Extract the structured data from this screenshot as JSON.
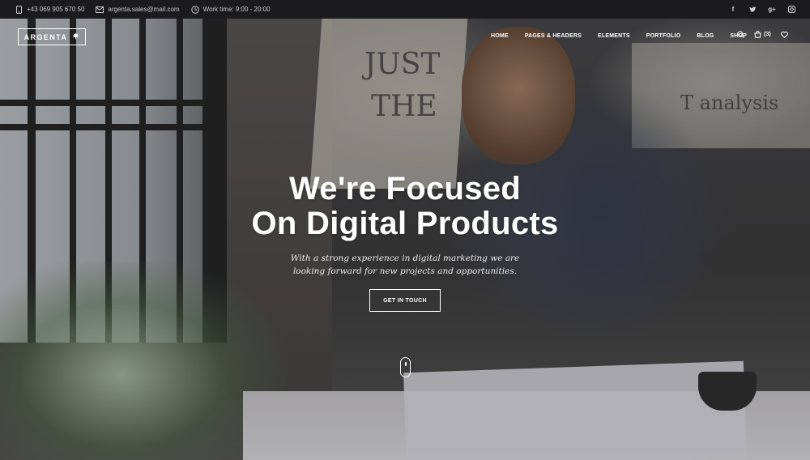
{
  "topbar": {
    "phone": "+43 069 905 670 50",
    "email": "argenta.sales@mail.com",
    "work_time": "Work time: 9:00 - 20:00",
    "social": [
      {
        "icon": "facebook-icon",
        "glyph": "f"
      },
      {
        "icon": "twitter-icon",
        "glyph": "t"
      },
      {
        "icon": "google-plus-icon",
        "glyph": "g+"
      },
      {
        "icon": "instagram-icon",
        "glyph": "◘"
      }
    ]
  },
  "header": {
    "logo": "ARGENTA",
    "nav": [
      "HOME",
      "PAGES & HEADERS",
      "ELEMENTS",
      "PORTFOLIO",
      "BLOG",
      "SHOP"
    ],
    "cart_count": "(3)"
  },
  "hero": {
    "title_line1": "We're Focused",
    "title_line2": "On Digital Products",
    "subtitle": "With a strong experience in digital marketing we are looking forward for new projects and opportunities.",
    "cta": "GET IN TOUCH",
    "scrawl_1": "JUST",
    "scrawl_2": "THE",
    "scrawl_3": "T analysis"
  },
  "colors": {
    "topbar_bg": "#1b1b1d",
    "text": "#ffffff"
  }
}
